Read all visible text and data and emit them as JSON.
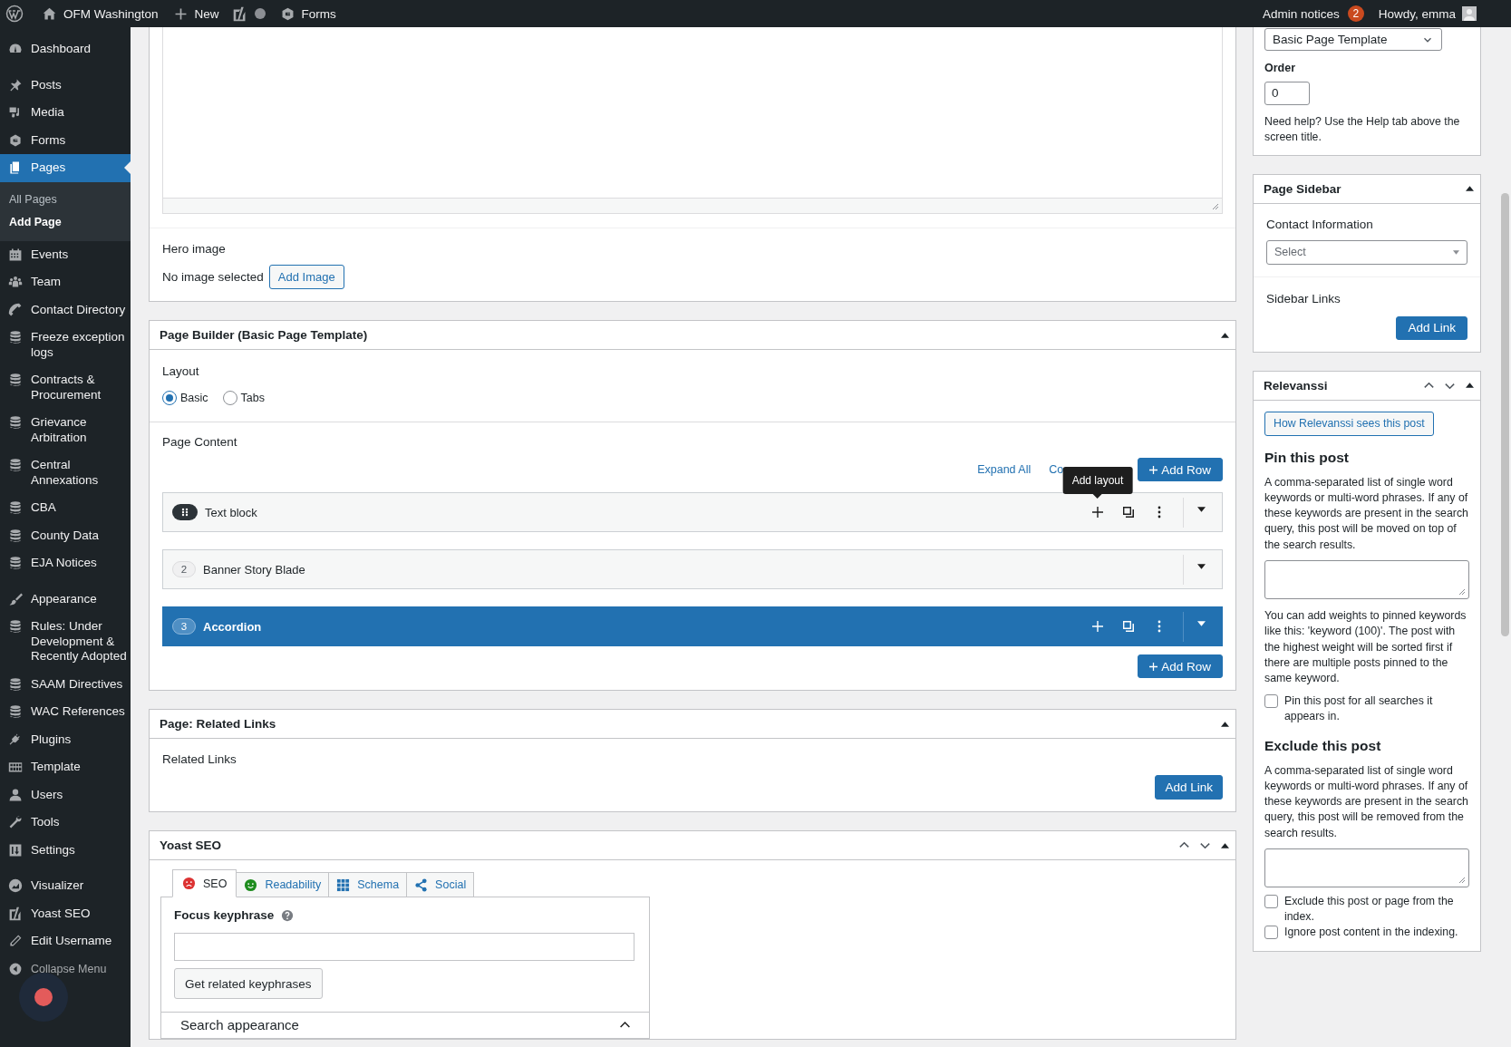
{
  "admin_bar": {
    "site_name": "OFM Washington",
    "new_label": "New",
    "forms_label": "Forms",
    "notices_label": "Admin notices",
    "notices_count": "2",
    "greeting": "Howdy, emma"
  },
  "sidebar": {
    "groups": [
      {
        "items": [
          {
            "label": "Dashboard",
            "kind": "dashboard",
            "selected": false
          }
        ]
      },
      {
        "items": [
          {
            "label": "Posts",
            "kind": "posts",
            "selected": false
          },
          {
            "label": "Media",
            "kind": "media",
            "selected": false
          },
          {
            "label": "Forms",
            "kind": "forms",
            "selected": false
          },
          {
            "label": "Pages",
            "kind": "pages",
            "selected": true,
            "children": [
              {
                "label": "All Pages",
                "selected": false
              },
              {
                "label": "Add Page",
                "selected": true
              }
            ]
          },
          {
            "label": "Events",
            "kind": "events",
            "selected": false
          },
          {
            "label": "Team",
            "kind": "team",
            "selected": false
          },
          {
            "label": "Contact Directory",
            "kind": "phone",
            "selected": false
          },
          {
            "label": "Freeze exception logs",
            "kind": "database",
            "selected": false
          },
          {
            "label": "Contracts & Procurement",
            "kind": "database",
            "selected": false
          },
          {
            "label": "Grievance Arbitration",
            "kind": "database",
            "selected": false
          },
          {
            "label": "Central Annexations",
            "kind": "database",
            "selected": false
          },
          {
            "label": "CBA",
            "kind": "database",
            "selected": false
          },
          {
            "label": "County Data",
            "kind": "database",
            "selected": false
          },
          {
            "label": "EJA Notices",
            "kind": "database",
            "selected": false
          }
        ]
      },
      {
        "items": [
          {
            "label": "Appearance",
            "kind": "appearance",
            "selected": false
          },
          {
            "label": "Rules: Under Development & Recently Adopted",
            "kind": "database",
            "selected": false
          },
          {
            "label": "SAAM Directives",
            "kind": "database",
            "selected": false
          },
          {
            "label": "WAC References",
            "kind": "database",
            "selected": false
          },
          {
            "label": "Plugins",
            "kind": "plugins",
            "selected": false
          },
          {
            "label": "Template",
            "kind": "template",
            "selected": false
          },
          {
            "label": "Users",
            "kind": "users",
            "selected": false
          },
          {
            "label": "Tools",
            "kind": "tools",
            "selected": false
          },
          {
            "label": "Settings",
            "kind": "settings",
            "selected": false
          }
        ]
      },
      {
        "items": [
          {
            "label": "Visualizer",
            "kind": "visualizer",
            "selected": false
          },
          {
            "label": "Yoast SEO",
            "kind": "logo",
            "selected": false
          },
          {
            "label": "Edit Username",
            "kind": "pencil",
            "selected": false
          }
        ]
      }
    ],
    "collapse_label": "Collapse Menu"
  },
  "hero_image": {
    "label": "Hero image",
    "status": "No image selected",
    "button": "Add Image"
  },
  "page_builder": {
    "title": "Page Builder (Basic Page Template)",
    "layout_label": "Layout",
    "layout_options": [
      {
        "label": "Basic",
        "selected": true
      },
      {
        "label": "Tabs",
        "selected": false
      }
    ],
    "content_label": "Page Content",
    "expand_all": "Expand All",
    "collapse_all": "Co",
    "top_add_row": "Add Row",
    "tooltip": "Add layout",
    "rows": [
      {
        "title": "Text block",
        "hovered": true,
        "selected": false
      },
      {
        "number": "2",
        "title": "Banner Story Blade",
        "hovered": false,
        "selected": false
      },
      {
        "number": "3",
        "title": "Accordion",
        "hovered": false,
        "selected": true
      }
    ],
    "bottom_add_row": "Add Row"
  },
  "related_links": {
    "title": "Page: Related Links",
    "label": "Related Links",
    "button": "Add Link"
  },
  "yoast": {
    "title": "Yoast SEO",
    "tabs": [
      {
        "label": "SEO",
        "kind": "sad-face",
        "selected": true
      },
      {
        "label": "Readability",
        "kind": "smiley",
        "selected": false
      },
      {
        "label": "Schema",
        "kind": "grid",
        "selected": false
      },
      {
        "label": "Social",
        "kind": "share",
        "selected": false
      }
    ],
    "focus_label": "Focus keyphrase",
    "related_button": "Get related keyphrases",
    "section": "Search appearance"
  },
  "page_attributes": {
    "template": "Basic Page Template",
    "order_label": "Order",
    "order_value": "0",
    "help": "Need help? Use the Help tab above the screen title."
  },
  "page_sidebar": {
    "title": "Page Sidebar",
    "contact_label": "Contact Information",
    "select_placeholder": "Select",
    "links_label": "Sidebar Links",
    "button": "Add Link"
  },
  "relevanssi": {
    "title": "Relevanssi",
    "button": "How Relevanssi sees this post",
    "pin_heading": "Pin this post",
    "pin_text": "A comma-separated list of single word keywords or multi-word phrases. If any of these keywords are present in the search query, this post will be moved on top of the search results.",
    "pin_note": "You can add weights to pinned keywords like this: 'keyword (100)'. The post with the highest weight will be sorted first if there are multiple posts pinned to the same keyword.",
    "pin_checks": [
      {
        "label": "Pin this post for all searches it appears in.",
        "checked": false
      }
    ],
    "exclude_heading": "Exclude this post",
    "exclude_text": "A comma-separated list of single word keywords or multi-word phrases. If any of these keywords are present in the search query, this post will be removed from the search results.",
    "exclude_checks": [
      {
        "label": "Exclude this post or page from the index.",
        "checked": false
      },
      {
        "label": "Ignore post content in the indexing.",
        "checked": false
      }
    ]
  }
}
